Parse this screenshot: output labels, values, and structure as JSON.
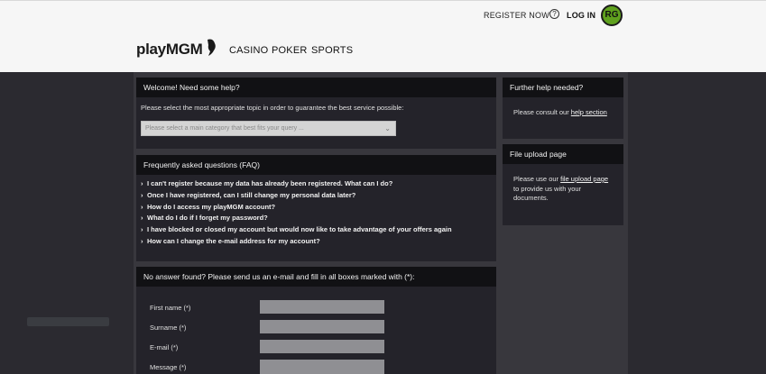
{
  "header": {
    "register_label": "REGISTER NOW",
    "help_icon": "?",
    "login_label": "LOG IN",
    "rg_badge": "RG",
    "logo_play": "play",
    "logo_mgm": "MGM",
    "nav": [
      "CASINO",
      "POKER",
      "SPORTS"
    ]
  },
  "welcome": {
    "title": "Welcome! Need some help?",
    "instruction": "Please select the most appropriate topic in order to guarantee the best service possible:",
    "select_placeholder": "Please select a main category that best fits your query ..."
  },
  "faq": {
    "title": "Frequently asked questions (FAQ)",
    "items": [
      "I can't register because my data has already been registered. What can I do?",
      "Once I have registered, can I still change my personal data later?",
      "How do I access my playMGM account?",
      "What do I do if I forget my password?",
      "I have blocked or closed my account but would now like to take advantage of your offers again",
      "How can I change the e-mail address for my account?"
    ]
  },
  "contact_form": {
    "title": "No answer found? Please send us an e-mail and fill in all boxes marked with (*):",
    "fields": [
      "First name (*)",
      "Surname (*)",
      "E-mail (*)",
      "Message (*)"
    ]
  },
  "further_help": {
    "title": "Further help needed?",
    "text": "Please consult our",
    "link": "help section"
  },
  "file_upload": {
    "title": "File upload page",
    "text_before": "Please use our",
    "link": "file upload page",
    "text_after_1": "to provide us with your",
    "text_after_2": "documents."
  },
  "colors": {
    "header_bg": "#f6f6f6",
    "page_bg": "#2b2a30",
    "card_head_bg": "#111114",
    "rg_green": "#5fa11e"
  }
}
